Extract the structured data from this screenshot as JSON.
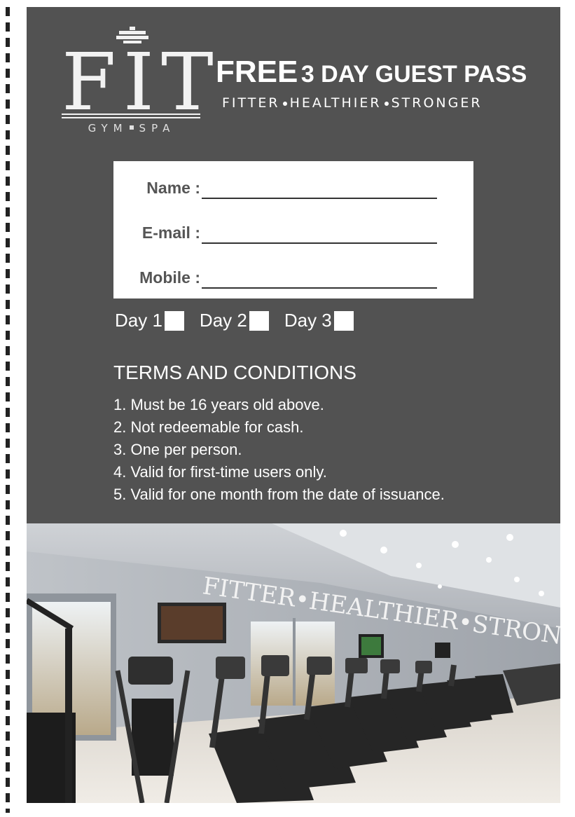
{
  "logo": {
    "word": "FIT",
    "subtitle_left": "GYM",
    "subtitle_right": "SPA"
  },
  "headline": {
    "free": "FREE",
    "rest": "3 DAY GUEST PASS"
  },
  "tagline": {
    "part1": "FITTER",
    "part2": "HEALTHIER",
    "part3": "STRONGER"
  },
  "form": {
    "name_label": "Name :",
    "email_label": "E-mail :",
    "mobile_label": "Mobile :"
  },
  "days": [
    "Day 1",
    "Day 2",
    "Day 3"
  ],
  "terms": {
    "title": "TERMS AND CONDITIONS",
    "items": [
      "1. Must be 16 years old above.",
      "2. Not redeemable for cash.",
      "3. One per person.",
      "4. Valid for first-time users only.",
      "5. Valid for one month from the date of issuance."
    ]
  },
  "photo": {
    "wall_text": "FITTER•HEALTHIER•STRONGER"
  },
  "colors": {
    "card": "#525252",
    "text": "#ffffff",
    "form_bg": "#ffffff",
    "label": "#555555"
  }
}
